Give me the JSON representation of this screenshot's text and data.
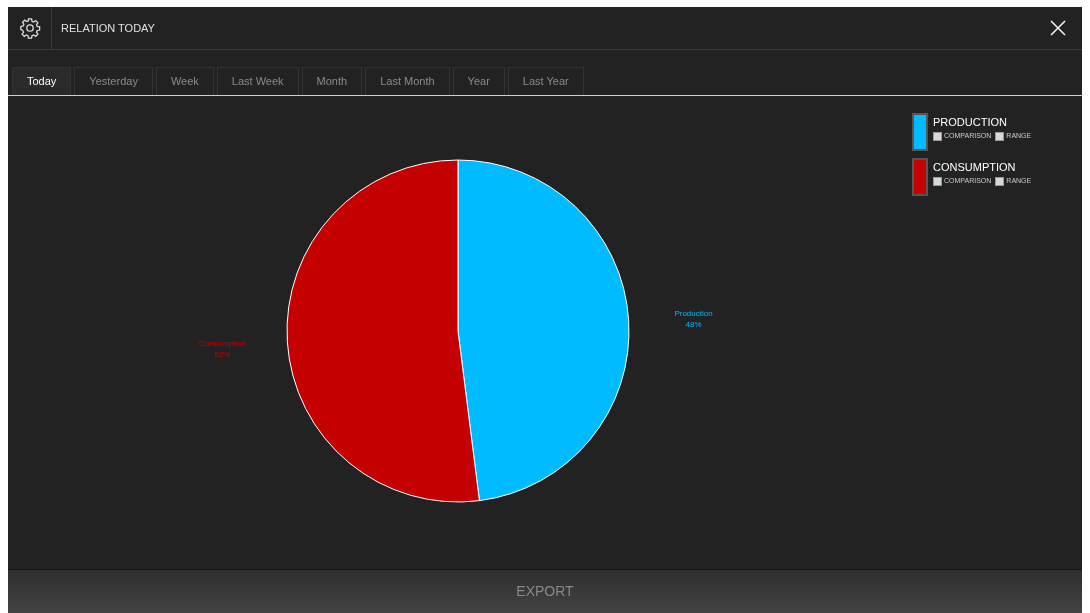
{
  "window": {
    "title": "RELATION TODAY"
  },
  "tabs": [
    {
      "label": "Today",
      "selected": true
    },
    {
      "label": "Yesterday",
      "selected": false
    },
    {
      "label": "Week",
      "selected": false
    },
    {
      "label": "Last Week",
      "selected": false
    },
    {
      "label": "Month",
      "selected": false
    },
    {
      "label": "Last Month",
      "selected": false
    },
    {
      "label": "Year",
      "selected": false
    },
    {
      "label": "Last Year",
      "selected": false
    }
  ],
  "legend": [
    {
      "label": "PRODUCTION",
      "color": "#00bbff",
      "options": [
        {
          "label": "COMPARISON",
          "checked": false
        },
        {
          "label": "RANGE",
          "checked": false
        }
      ]
    },
    {
      "label": "CONSUMPTION",
      "color": "#c40000",
      "options": [
        {
          "label": "COMPARISON",
          "checked": false
        },
        {
          "label": "RANGE",
          "checked": false
        }
      ]
    }
  ],
  "chart": {
    "chart_data": {
      "type": "pie",
      "categories": [
        "Production",
        "Consumption"
      ],
      "values": [
        48,
        52
      ],
      "colors": [
        "#00bbff",
        "#c40000"
      ],
      "value_labels": [
        "48%",
        "52%"
      ]
    }
  },
  "footer": {
    "button": "EXPORT"
  }
}
